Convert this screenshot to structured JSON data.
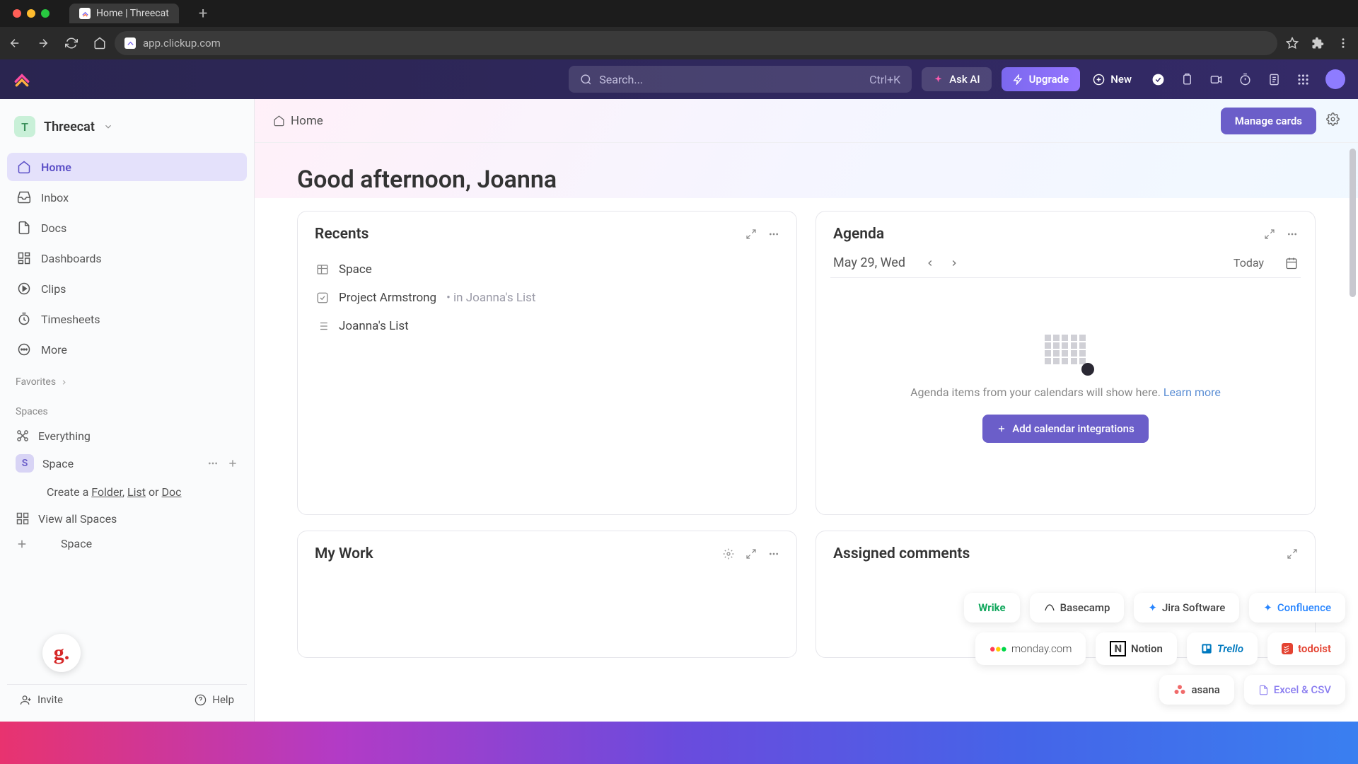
{
  "browser": {
    "tab_title": "Home | Threecat",
    "url": "app.clickup.com"
  },
  "topbar": {
    "search_placeholder": "Search...",
    "search_shortcut": "Ctrl+K",
    "ask_ai": "Ask AI",
    "upgrade": "Upgrade",
    "new": "New"
  },
  "workspace": {
    "badge": "T",
    "name": "Threecat"
  },
  "sidebar": {
    "items": [
      {
        "label": "Home"
      },
      {
        "label": "Inbox"
      },
      {
        "label": "Docs"
      },
      {
        "label": "Dashboards"
      },
      {
        "label": "Clips"
      },
      {
        "label": "Timesheets"
      },
      {
        "label": "More"
      }
    ],
    "favorites_label": "Favorites",
    "spaces_label": "Spaces",
    "everything": "Everything",
    "space": {
      "badge": "S",
      "name": "Space"
    },
    "create_prefix": "Create a ",
    "create_folder": "Folder",
    "create_list": "List",
    "create_doc": "Doc",
    "or": " or ",
    "view_all": "View all Spaces",
    "new_space_partial": "Space",
    "invite": "Invite",
    "help": "Help"
  },
  "breadcrumb": {
    "home": "Home"
  },
  "manage_cards": "Manage cards",
  "greeting": "Good afternoon, Joanna",
  "recents": {
    "title": "Recents",
    "items": [
      {
        "name": "Space"
      },
      {
        "name": "Project Armstrong",
        "in": "in Joanna's List"
      },
      {
        "name": "Joanna's List"
      }
    ]
  },
  "agenda": {
    "title": "Agenda",
    "date": "May 29, Wed",
    "today": "Today",
    "empty_text": "Agenda items from your calendars will show here. ",
    "learn_more": "Learn more",
    "add_btn": "Add calendar integrations"
  },
  "mywork": {
    "title": "My Work"
  },
  "assigned": {
    "title": "Assigned comments"
  },
  "chips": {
    "r1": [
      "Wrike",
      "Basecamp",
      "Jira Software",
      "Confluence"
    ],
    "r2": [
      "monday.com",
      "Notion",
      "Trello",
      "todoist"
    ],
    "r3": [
      "asana",
      "Excel & CSV"
    ]
  }
}
